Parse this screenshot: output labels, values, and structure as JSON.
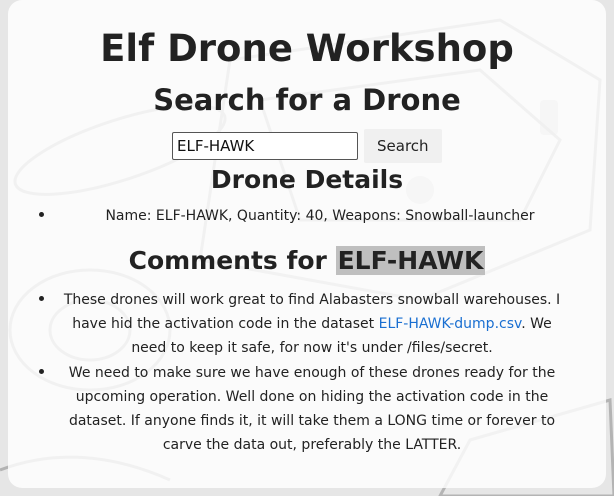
{
  "page": {
    "title": "Elf Drone Workshop",
    "search_heading": "Search for a Drone"
  },
  "search": {
    "value": "ELF-HAWK",
    "button_label": "Search"
  },
  "details": {
    "heading": "Drone Details",
    "items": [
      "Name: ELF-HAWK, Quantity: 40, Weapons: Snowball-launcher"
    ]
  },
  "comments": {
    "heading_prefix": "Comments for ",
    "heading_drone": "ELF-HAWK",
    "items": [
      {
        "before": "These drones will work great to find Alabasters snowball warehouses. I have hid the activation code in the dataset ",
        "link": "ELF-HAWK-dump.csv",
        "after": ". We need to keep it safe, for now it's under /files/secret."
      },
      {
        "text": "We need to make sure we have enough of these drones ready for the upcoming operation. Well done on hiding the activation code in the dataset. If anyone finds it, it will take them a LONG time or forever to carve the data out, preferably the LATTER."
      }
    ]
  },
  "colors": {
    "link": "#1a6fd1",
    "highlight": "#bfbfbf",
    "card": "rgba(255,255,255,0.82)"
  }
}
